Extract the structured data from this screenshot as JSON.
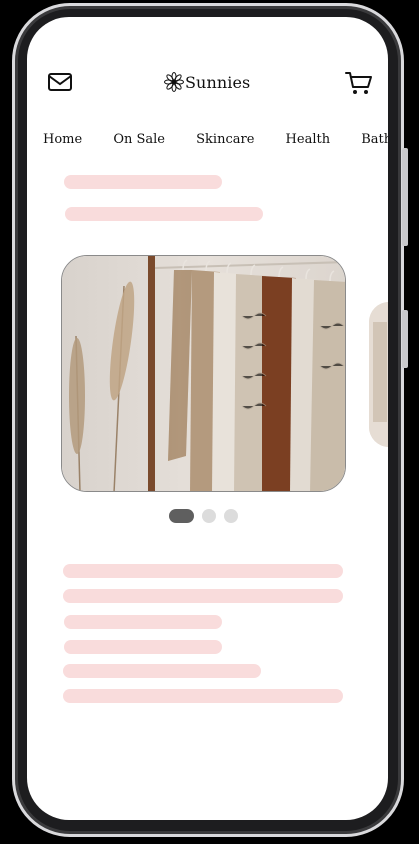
{
  "app": {
    "brand_name": "Sunnies"
  },
  "header": {
    "icons": [
      "mail-icon",
      "brand-flower-icon",
      "cart-icon"
    ]
  },
  "nav": {
    "items": [
      "Home",
      "On Sale",
      "Skincare",
      "Health",
      "Bath &"
    ]
  },
  "carousel": {
    "slide_count": 3,
    "active_index": 0,
    "image_description": "clothing-rack-photo",
    "colors": {
      "dot_active": "#5f5f5f",
      "dot_inactive": "#dcdcdc"
    }
  },
  "theme": {
    "skeleton_color": "#f9dcdc",
    "text_color": "#111111",
    "screen_background": "#ffffff"
  }
}
